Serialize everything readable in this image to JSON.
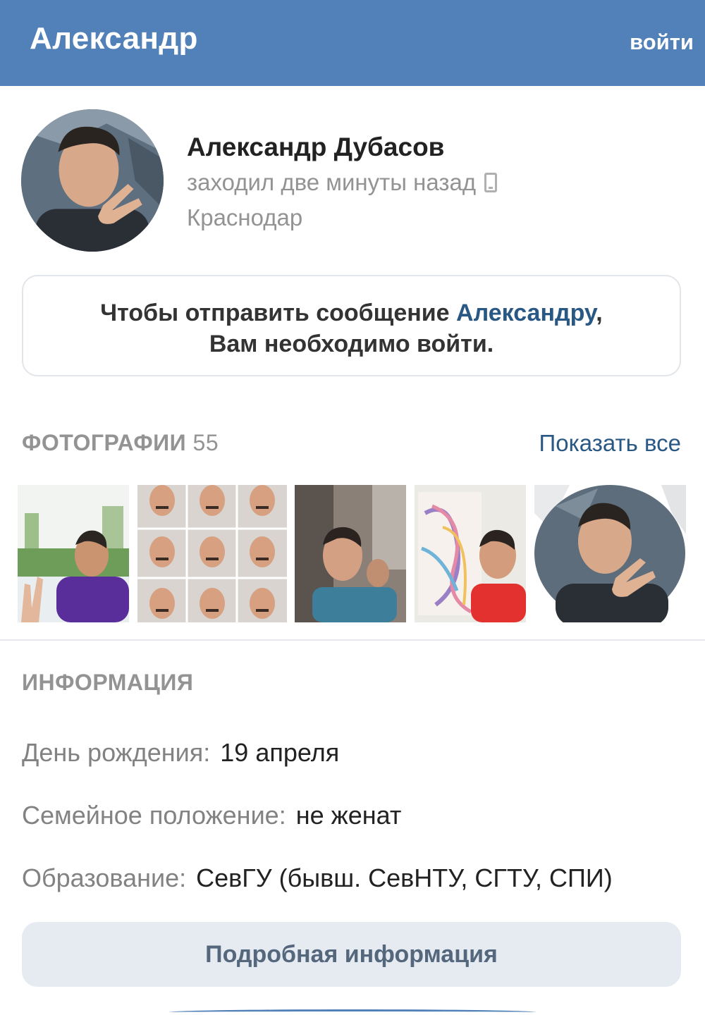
{
  "header": {
    "title": "Александр",
    "login_label": "войти"
  },
  "profile": {
    "name": "Александр Дубасов",
    "status": "заходил две минуты назад",
    "city": "Краснодар",
    "status_icon": "mobile-phone-icon"
  },
  "message": {
    "line1_prefix": "Чтобы отправить сообщение ",
    "line1_link": "Александру",
    "line1_suffix": ",",
    "line2": "Вам необходимо войти."
  },
  "photos": {
    "title": "ФОТОГРАФИИ",
    "count": "55",
    "show_all": "Показать все"
  },
  "info": {
    "title": "ИНФОРМАЦИЯ",
    "rows": [
      {
        "label": "День рождения:",
        "value": "19 апреля"
      },
      {
        "label": "Семейное положение:",
        "value": "не женат"
      },
      {
        "label": "Образование:",
        "value": "СевГУ (бывш. СевНТУ, СГТУ, СПИ)"
      }
    ],
    "more_button": "Подробная информация"
  },
  "colors": {
    "header_bg": "#5181b8",
    "link": "#2a5885",
    "secondary_text": "#939393",
    "button_bg": "#e5ebf1"
  }
}
